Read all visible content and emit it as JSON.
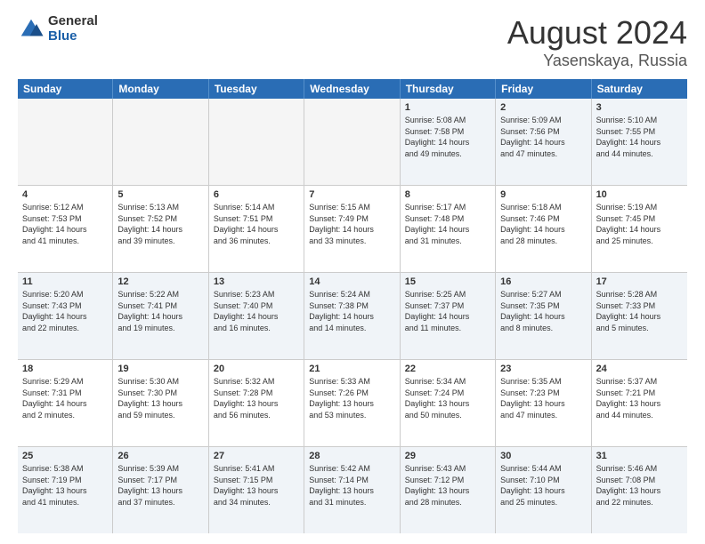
{
  "logo": {
    "general": "General",
    "blue": "Blue"
  },
  "title": {
    "month": "August 2024",
    "location": "Yasenskaya, Russia"
  },
  "header_days": [
    "Sunday",
    "Monday",
    "Tuesday",
    "Wednesday",
    "Thursday",
    "Friday",
    "Saturday"
  ],
  "weeks": [
    [
      {
        "day": "",
        "empty": true
      },
      {
        "day": "",
        "empty": true
      },
      {
        "day": "",
        "empty": true
      },
      {
        "day": "",
        "empty": true
      },
      {
        "day": "1",
        "lines": [
          "Sunrise: 5:08 AM",
          "Sunset: 7:58 PM",
          "Daylight: 14 hours",
          "and 49 minutes."
        ]
      },
      {
        "day": "2",
        "lines": [
          "Sunrise: 5:09 AM",
          "Sunset: 7:56 PM",
          "Daylight: 14 hours",
          "and 47 minutes."
        ]
      },
      {
        "day": "3",
        "lines": [
          "Sunrise: 5:10 AM",
          "Sunset: 7:55 PM",
          "Daylight: 14 hours",
          "and 44 minutes."
        ]
      }
    ],
    [
      {
        "day": "4",
        "lines": [
          "Sunrise: 5:12 AM",
          "Sunset: 7:53 PM",
          "Daylight: 14 hours",
          "and 41 minutes."
        ]
      },
      {
        "day": "5",
        "lines": [
          "Sunrise: 5:13 AM",
          "Sunset: 7:52 PM",
          "Daylight: 14 hours",
          "and 39 minutes."
        ]
      },
      {
        "day": "6",
        "lines": [
          "Sunrise: 5:14 AM",
          "Sunset: 7:51 PM",
          "Daylight: 14 hours",
          "and 36 minutes."
        ]
      },
      {
        "day": "7",
        "lines": [
          "Sunrise: 5:15 AM",
          "Sunset: 7:49 PM",
          "Daylight: 14 hours",
          "and 33 minutes."
        ]
      },
      {
        "day": "8",
        "lines": [
          "Sunrise: 5:17 AM",
          "Sunset: 7:48 PM",
          "Daylight: 14 hours",
          "and 31 minutes."
        ]
      },
      {
        "day": "9",
        "lines": [
          "Sunrise: 5:18 AM",
          "Sunset: 7:46 PM",
          "Daylight: 14 hours",
          "and 28 minutes."
        ]
      },
      {
        "day": "10",
        "lines": [
          "Sunrise: 5:19 AM",
          "Sunset: 7:45 PM",
          "Daylight: 14 hours",
          "and 25 minutes."
        ]
      }
    ],
    [
      {
        "day": "11",
        "lines": [
          "Sunrise: 5:20 AM",
          "Sunset: 7:43 PM",
          "Daylight: 14 hours",
          "and 22 minutes."
        ]
      },
      {
        "day": "12",
        "lines": [
          "Sunrise: 5:22 AM",
          "Sunset: 7:41 PM",
          "Daylight: 14 hours",
          "and 19 minutes."
        ]
      },
      {
        "day": "13",
        "lines": [
          "Sunrise: 5:23 AM",
          "Sunset: 7:40 PM",
          "Daylight: 14 hours",
          "and 16 minutes."
        ]
      },
      {
        "day": "14",
        "lines": [
          "Sunrise: 5:24 AM",
          "Sunset: 7:38 PM",
          "Daylight: 14 hours",
          "and 14 minutes."
        ]
      },
      {
        "day": "15",
        "lines": [
          "Sunrise: 5:25 AM",
          "Sunset: 7:37 PM",
          "Daylight: 14 hours",
          "and 11 minutes."
        ]
      },
      {
        "day": "16",
        "lines": [
          "Sunrise: 5:27 AM",
          "Sunset: 7:35 PM",
          "Daylight: 14 hours",
          "and 8 minutes."
        ]
      },
      {
        "day": "17",
        "lines": [
          "Sunrise: 5:28 AM",
          "Sunset: 7:33 PM",
          "Daylight: 14 hours",
          "and 5 minutes."
        ]
      }
    ],
    [
      {
        "day": "18",
        "lines": [
          "Sunrise: 5:29 AM",
          "Sunset: 7:31 PM",
          "Daylight: 14 hours",
          "and 2 minutes."
        ]
      },
      {
        "day": "19",
        "lines": [
          "Sunrise: 5:30 AM",
          "Sunset: 7:30 PM",
          "Daylight: 13 hours",
          "and 59 minutes."
        ]
      },
      {
        "day": "20",
        "lines": [
          "Sunrise: 5:32 AM",
          "Sunset: 7:28 PM",
          "Daylight: 13 hours",
          "and 56 minutes."
        ]
      },
      {
        "day": "21",
        "lines": [
          "Sunrise: 5:33 AM",
          "Sunset: 7:26 PM",
          "Daylight: 13 hours",
          "and 53 minutes."
        ]
      },
      {
        "day": "22",
        "lines": [
          "Sunrise: 5:34 AM",
          "Sunset: 7:24 PM",
          "Daylight: 13 hours",
          "and 50 minutes."
        ]
      },
      {
        "day": "23",
        "lines": [
          "Sunrise: 5:35 AM",
          "Sunset: 7:23 PM",
          "Daylight: 13 hours",
          "and 47 minutes."
        ]
      },
      {
        "day": "24",
        "lines": [
          "Sunrise: 5:37 AM",
          "Sunset: 7:21 PM",
          "Daylight: 13 hours",
          "and 44 minutes."
        ]
      }
    ],
    [
      {
        "day": "25",
        "lines": [
          "Sunrise: 5:38 AM",
          "Sunset: 7:19 PM",
          "Daylight: 13 hours",
          "and 41 minutes."
        ]
      },
      {
        "day": "26",
        "lines": [
          "Sunrise: 5:39 AM",
          "Sunset: 7:17 PM",
          "Daylight: 13 hours",
          "and 37 minutes."
        ]
      },
      {
        "day": "27",
        "lines": [
          "Sunrise: 5:41 AM",
          "Sunset: 7:15 PM",
          "Daylight: 13 hours",
          "and 34 minutes."
        ]
      },
      {
        "day": "28",
        "lines": [
          "Sunrise: 5:42 AM",
          "Sunset: 7:14 PM",
          "Daylight: 13 hours",
          "and 31 minutes."
        ]
      },
      {
        "day": "29",
        "lines": [
          "Sunrise: 5:43 AM",
          "Sunset: 7:12 PM",
          "Daylight: 13 hours",
          "and 28 minutes."
        ]
      },
      {
        "day": "30",
        "lines": [
          "Sunrise: 5:44 AM",
          "Sunset: 7:10 PM",
          "Daylight: 13 hours",
          "and 25 minutes."
        ]
      },
      {
        "day": "31",
        "lines": [
          "Sunrise: 5:46 AM",
          "Sunset: 7:08 PM",
          "Daylight: 13 hours",
          "and 22 minutes."
        ]
      }
    ]
  ]
}
